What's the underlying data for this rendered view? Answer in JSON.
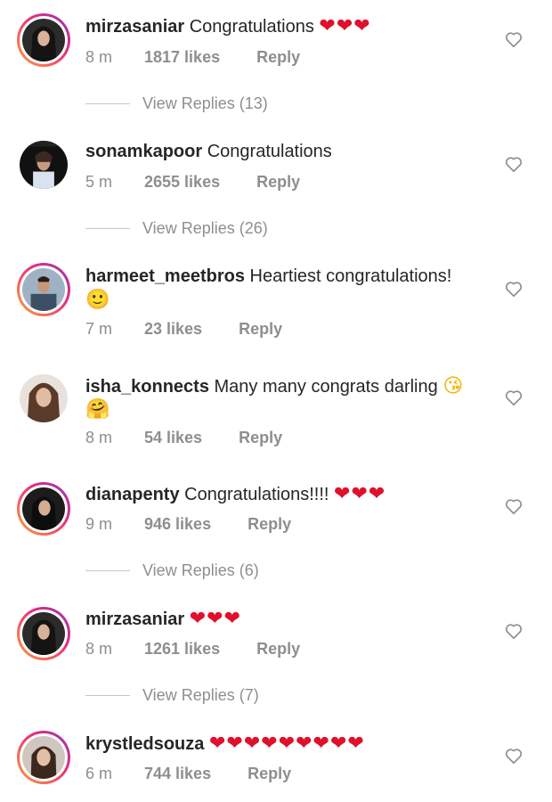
{
  "comments": [
    {
      "username": "mirzasaniar",
      "text": "Congratulations",
      "emoji": "❤❤❤",
      "text2": "",
      "time": "8 m",
      "likes": "1817 likes",
      "reply": "Reply",
      "view_replies": "View Replies (13)"
    },
    {
      "username": "sonamkapoor",
      "text": "Congratulations",
      "emoji": "",
      "text2": "",
      "time": "5 m",
      "likes": "2655 likes",
      "reply": "Reply",
      "view_replies": "View Replies (26)"
    },
    {
      "username": "harmeet_meetbros",
      "text": "Heartiest congratulations!",
      "emoji": "",
      "text2": "🙂",
      "time": "7 m",
      "likes": "23 likes",
      "reply": "Reply",
      "view_replies": ""
    },
    {
      "username": "isha_konnects",
      "text": "Many many congrats darling",
      "emoji": "😘",
      "text2": "🤗",
      "time": "8 m",
      "likes": "54 likes",
      "reply": "Reply",
      "view_replies": ""
    },
    {
      "username": "dianapenty",
      "text": "Congratulations!!!!",
      "emoji": "❤❤❤",
      "text2": "",
      "time": "9 m",
      "likes": "946 likes",
      "reply": "Reply",
      "view_replies": "View Replies (6)"
    },
    {
      "username": "mirzasaniar",
      "text": "",
      "emoji": "❤❤❤",
      "text2": "",
      "time": "8 m",
      "likes": "1261 likes",
      "reply": "Reply",
      "view_replies": "View Replies (7)"
    },
    {
      "username": "krystledsouza",
      "text": "",
      "emoji": "❤❤❤❤❤❤❤❤❤",
      "text2": "",
      "time": "6 m",
      "likes": "744 likes",
      "reply": "Reply",
      "view_replies": ""
    }
  ],
  "icons": {
    "like": "heart-outline-icon"
  },
  "colors": {
    "username": "#262626",
    "meta": "#8e8e8e",
    "heart": "#e0102b"
  }
}
